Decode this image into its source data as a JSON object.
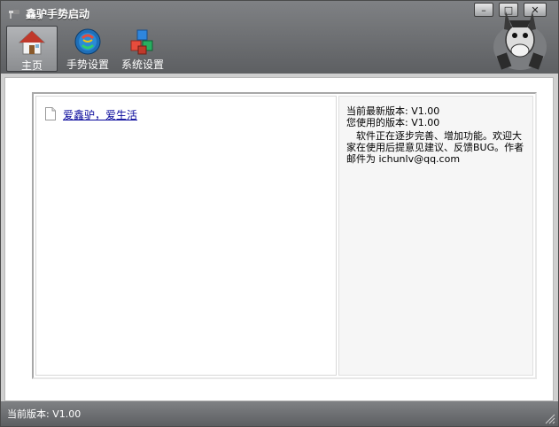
{
  "window": {
    "title": "鑫驴手势启动",
    "controls": {
      "minimize": "–",
      "maximize": "□",
      "close": "✕"
    }
  },
  "toolbar": {
    "items": [
      {
        "label": "主页",
        "icon": "home-icon",
        "active": true
      },
      {
        "label": "手势设置",
        "icon": "gesture-settings-icon"
      },
      {
        "label": "系统设置",
        "icon": "system-settings-icon"
      }
    ]
  },
  "main": {
    "link_text": "爱鑫驴，爱生活",
    "version_latest": "当前最新版本: V1.00",
    "version_current": "您使用的版本: V1.00",
    "description": "软件正在逐步完善、增加功能。欢迎大家在使用后提意见建议、反馈BUG。作者邮件为 ichunlv@qq.com"
  },
  "status": {
    "text": "当前版本: V1.00"
  },
  "colors": {
    "chrome": "#6e7073",
    "link": "#0a0a9c",
    "content_bg": "#ffffff"
  }
}
